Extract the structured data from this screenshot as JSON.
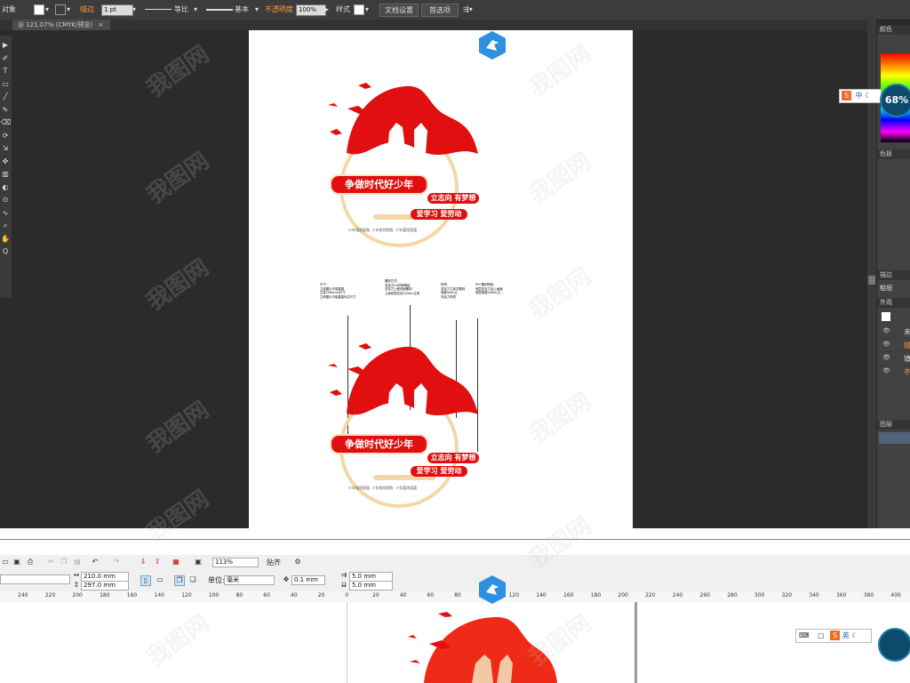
{
  "illustrator": {
    "control_bar": {
      "selection": "对象",
      "stroke_label": "描边",
      "stroke_weight": "1 pt",
      "profile_label": "等比",
      "brush_label": "基本",
      "opacity_label": "不透明度",
      "opacity_value": "100%",
      "style_label": "样式",
      "doc_setup_button": "文档设置",
      "preferences_button": "首选项"
    },
    "document_tab": "@ 121.07% (CMYK/预览)",
    "tools": [
      "▶",
      "✐",
      "T",
      "▭",
      "╱",
      "✎",
      "⌫",
      "⟳",
      "⇲",
      "✜",
      "▥",
      "◐",
      "⊙",
      "∿",
      "⌕",
      "✋",
      "Q"
    ],
    "panels": {
      "color_title": "颜色",
      "swatches_title": "色板",
      "stroke_title": "描边",
      "weight_label": "粗细",
      "appearance_title": "外观",
      "layers_title": "图层",
      "appearance_rows": [
        "未",
        "描",
        "填",
        "不"
      ]
    }
  },
  "design": {
    "title": "争做时代好少年",
    "tag1": "立志向 有梦想",
    "tag2": "爱学习 爱劳动",
    "slogans": [
      "少年强则国强",
      "少年智则国智",
      "少年富则国富"
    ],
    "annotations": [
      [
        "尺寸：",
        "立体图片不能直接",
        "注意1000mm尺寸",
        "立体图片不能直接标注尺寸"
      ],
      [
        "雕刻方式：",
        "亚克力UV印刷喷绘",
        "亚克力上做双面雕刻",
        "上面双层亚克力5mm立体"
      ],
      [
        "材质：",
        "亚克力立体字雕刻",
        "厚度5mm立",
        "亚克力材质"
      ],
      [
        "PVC雕刻喷绘：",
        "底层亚克力加上画面",
        "底层厚度10mm立..."
      ]
    ]
  },
  "corel": {
    "zoom": "113%",
    "snap_label": "贴齐",
    "width": "210.0 mm",
    "height": "297.0 mm",
    "unit_label": "单位:",
    "unit_value": "毫米",
    "nudge": "0.1 mm",
    "dup_x": "5.0 mm",
    "dup_y": "5.0 mm",
    "ruler_marks": [
      "240",
      "220",
      "200",
      "180",
      "160",
      "140",
      "120",
      "100",
      "80",
      "60",
      "40",
      "20",
      "0",
      "20",
      "40",
      "60",
      "80",
      "100",
      "120",
      "140",
      "160",
      "180",
      "200",
      "220",
      "240",
      "260",
      "280",
      "300",
      "320",
      "340",
      "360",
      "380",
      "400"
    ]
  },
  "overlay": {
    "ime_label_1": "中",
    "ime_label_2": "英",
    "percent_badge": "68%",
    "watermark": "我图网"
  },
  "colors": {
    "brand_red": "#e10f0f",
    "cream": "#f6e1bf",
    "ui_dark": "#3c3c3c",
    "watermark_blue": "#2f8fe0"
  }
}
